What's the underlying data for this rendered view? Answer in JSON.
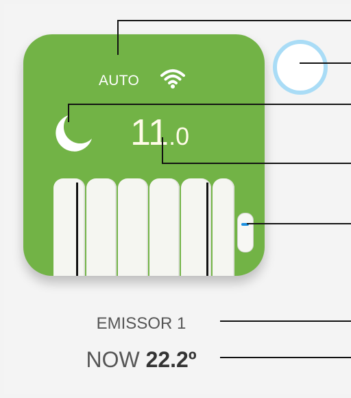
{
  "device": {
    "mode": "AUTO",
    "status_icons": [
      "wifi-icon",
      "moon-icon"
    ],
    "setpoint_int": "11",
    "setpoint_dec": ".0",
    "power_state": "off",
    "indicator_color": "#1a8fe0",
    "card_color": "#72b346",
    "toggle_ring_color": "#a9dcf6"
  },
  "emitter": {
    "name": "EMISSOR 1",
    "now_label": "NOW",
    "now_value": "22.2º"
  }
}
